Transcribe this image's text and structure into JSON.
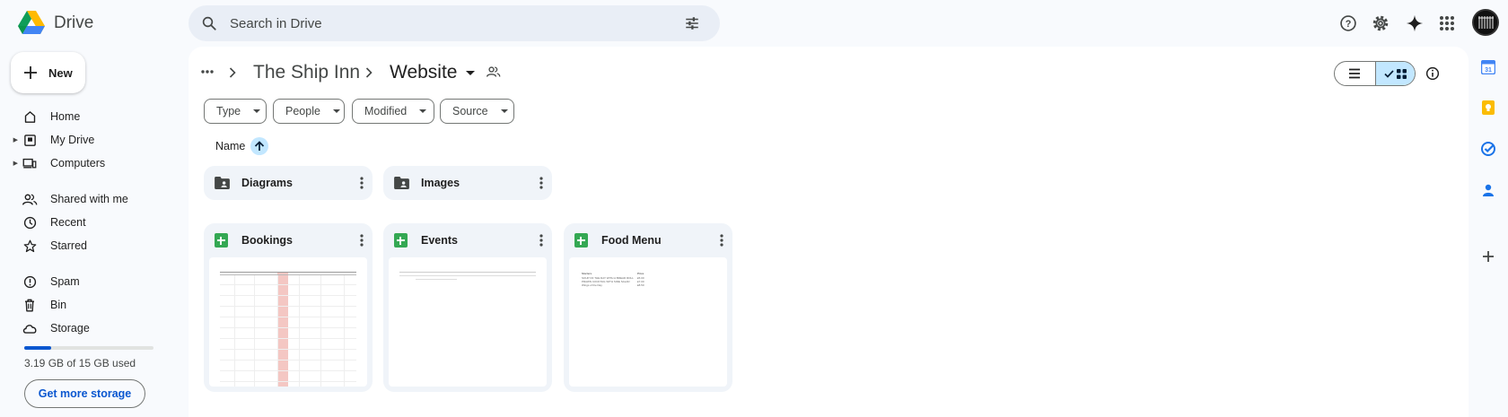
{
  "app": {
    "name": "Drive"
  },
  "search": {
    "placeholder": "Search in Drive"
  },
  "sidebar": {
    "new_label": "New",
    "items": [
      {
        "label": "Home"
      },
      {
        "label": "My Drive"
      },
      {
        "label": "Computers"
      },
      {
        "label": "Shared with me"
      },
      {
        "label": "Recent"
      },
      {
        "label": "Starred"
      },
      {
        "label": "Spam"
      },
      {
        "label": "Bin"
      },
      {
        "label": "Storage"
      }
    ],
    "storage_used_fraction": 0.21,
    "storage_text": "3.19 GB of 15 GB used",
    "get_storage_label": "Get more storage"
  },
  "breadcrumb": {
    "parent": "The Ship Inn",
    "current": "Website"
  },
  "filters": [
    "Type",
    "People",
    "Modified",
    "Source"
  ],
  "sort": {
    "label": "Name"
  },
  "folders": [
    {
      "name": "Diagrams"
    },
    {
      "name": "Images"
    }
  ],
  "files": [
    {
      "name": "Bookings"
    },
    {
      "name": "Events"
    },
    {
      "name": "Food Menu"
    }
  ],
  "food_menu_preview": {
    "headers": [
      "Starters",
      "Price"
    ],
    "rows": [
      [
        "SOUP OF THE DAY WITH A BREAD ROLL",
        "£5.00"
      ],
      [
        "PRAWN COCKTAIL WITH SIDE SALAD",
        "£7.00"
      ],
      [
        "Wings of the Day",
        "£8.50"
      ]
    ]
  },
  "colors": {
    "accent": "#0b57d0",
    "selected": "#c2e7ff",
    "sheets_green": "#34a853"
  }
}
